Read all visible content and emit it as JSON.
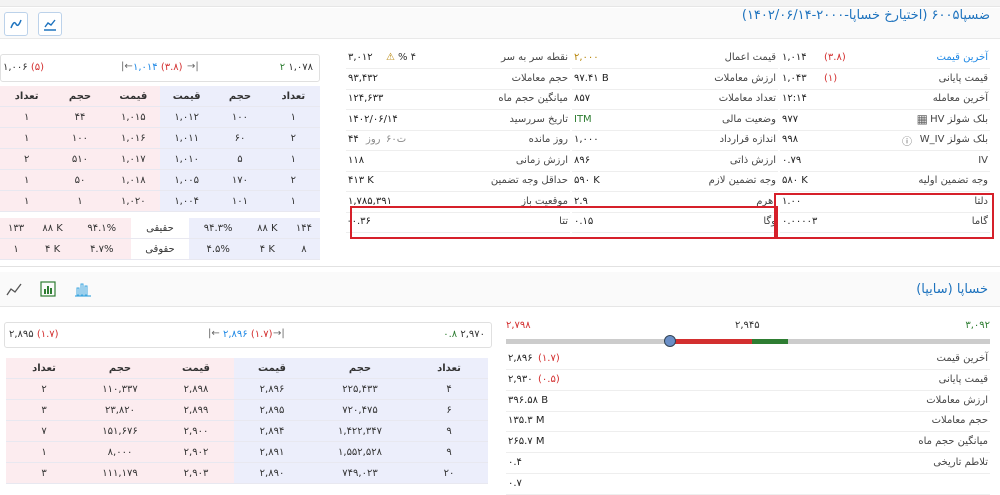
{
  "option": {
    "title": "ضسپا۶۰۰۵ (اختیارخ خساپا-۲۰۰۰-۱۴۰۲/۰۶/۱۴)",
    "col3": [
      {
        "label": "آخرین قیمت",
        "value": "۱,۰۱۴",
        "chg": "(۳.۸)"
      },
      {
        "label": "قیمت پایانی",
        "value": "۱,۰۴۳",
        "chg": "(۱)"
      },
      {
        "label": "آخرین معامله",
        "value": "۱۲:۱۴"
      },
      {
        "label": "بلک شولز HV",
        "value": "۹۷۷"
      },
      {
        "label": "بلک شولز W_IV",
        "value": "۹۹۸"
      },
      {
        "label": "IV",
        "value": "۰.۷۹"
      },
      {
        "label": "وجه تضمین اولیه",
        "value": "۵۸۰ K"
      },
      {
        "label": "دلتا",
        "value": "۱.۰۰"
      },
      {
        "label": "گاما",
        "value": "۰.۰۰۰۰۳"
      }
    ],
    "col2": [
      {
        "label": "قیمت اعمال",
        "value": "۲,۰۰۰"
      },
      {
        "label": "ارزش معاملات",
        "value": "۹۷.۴۱ B"
      },
      {
        "label": "تعداد معاملات",
        "value": "۸۵۷"
      },
      {
        "label": "وضعیت مالی",
        "value": "ITM"
      },
      {
        "label": "اندازه قرارداد",
        "value": "۱,۰۰۰"
      },
      {
        "label": "ارزش ذاتی",
        "value": "۸۹۶"
      },
      {
        "label": "وجه تضمین لازم",
        "value": "۵۹۰ K"
      },
      {
        "label": "اهرم",
        "value": "۲.۹"
      },
      {
        "label": "وگا",
        "value": "۰.۱۵"
      }
    ],
    "col1": [
      {
        "label": "نقطه سر به سر",
        "value": "۳,۰۱۲",
        "pct": "% ۴"
      },
      {
        "label": "حجم معاملات",
        "value": "۹۳,۴۳۲"
      },
      {
        "label": "میانگین حجم ماه",
        "value": "۱۲۴,۶۳۳"
      },
      {
        "label": "تاریخ سررسید",
        "value": "۱۴۰۲/۰۶/۱۴"
      },
      {
        "label": "روز مانده",
        "value": "۴۴",
        "unit": "روز",
        "extra": "۶۰ت"
      },
      {
        "label": "ارزش زمانی",
        "value": "۱۱۸"
      },
      {
        "label": "حداقل وجه تضمین",
        "value": "۴۱۳ K"
      },
      {
        "label": "موقعیت باز",
        "value": "۱,۷۸۵,۳۹۱"
      },
      {
        "label": "تتا",
        "value": "-۰.۳۶"
      }
    ],
    "book": {
      "hi": "۱,۰۷۸",
      "hiMark": "۲",
      "mid": "۱,۰۱۴",
      "midChg": "(۳.۸)",
      "lo": "۱,۰۰۶",
      "loChg": "(۵)",
      "headers": [
        "تعداد",
        "حجم",
        "قیمت",
        "قیمت",
        "حجم",
        "تعداد"
      ],
      "rows": [
        [
          "۱",
          "۱۰۰",
          "۱,۰۱۲",
          "۱,۰۱۵",
          "۴۴",
          "۱"
        ],
        [
          "۲",
          "۶۰",
          "۱,۰۱۱",
          "۱,۰۱۶",
          "۱۰۰",
          "۱"
        ],
        [
          "۱",
          "۵",
          "۱,۰۱۰",
          "۱,۰۱۷",
          "۵۱۰",
          "۲"
        ],
        [
          "۲",
          "۱۷۰",
          "۱,۰۰۵",
          "۱,۰۱۸",
          "۵۰",
          "۱"
        ],
        [
          "۱",
          "۱۰۱",
          "۱,۰۰۴",
          "۱,۰۲۰",
          "۱",
          "۱"
        ]
      ],
      "summary": [
        [
          "۱۴۴",
          "۸۸ K",
          "۹۴.۳%",
          "حقیقی",
          "۹۴.۱%",
          "۸۸ K",
          "۱۳۳"
        ],
        [
          "۸",
          "۴ K",
          "۴.۵%",
          "حقوقی",
          "۴.۷%",
          "۴ K",
          "۱"
        ]
      ]
    }
  },
  "underlying": {
    "title": "خساپا (سایپا)",
    "range": {
      "low": "۲,۷۹۸",
      "mid": "۲,۹۴۵",
      "high": "۳,۰۹۲",
      "marker": 0.05
    },
    "stats": [
      {
        "label": "آخرین قیمت",
        "value": "۲,۸۹۶",
        "chg": "(۱.۷)"
      },
      {
        "label": "قیمت پایانی",
        "value": "۲,۹۳۰",
        "chg": "(۰.۵)"
      },
      {
        "label": "ارزش معاملات",
        "value": "۳۹۶.۵۸ B"
      },
      {
        "label": "حجم معاملات",
        "value": "۱۳۵.۳ M"
      },
      {
        "label": "میانگین حجم ماه",
        "value": "۲۶۵.۷ M"
      },
      {
        "label": "تلاطم تاریخی",
        "value": "۰.۴"
      },
      {
        "label": "",
        "value": "۰.۷"
      }
    ],
    "book": {
      "hi": "۲,۹۷۰",
      "hiMark": "۰.۸",
      "mid": "۲,۸۹۶",
      "midChg": "(۱.۷)",
      "lo": "۲,۸۹۵",
      "loChg": "(۱.۷)",
      "headers": [
        "تعداد",
        "حجم",
        "قیمت",
        "قیمت",
        "حجم",
        "تعداد"
      ],
      "rows": [
        [
          "۴",
          "۲۲۵,۴۳۳",
          "۲,۸۹۶",
          "۲,۸۹۸",
          "۱۱۰,۳۳۷",
          "۲"
        ],
        [
          "۶",
          "۷۲۰,۴۷۵",
          "۲,۸۹۵",
          "۲,۸۹۹",
          "۲۳,۸۲۰",
          "۳"
        ],
        [
          "۹",
          "۱,۴۲۲,۳۴۷",
          "۲,۸۹۴",
          "۲,۹۰۰",
          "۱۵۱,۶۷۶",
          "۷"
        ],
        [
          "۹",
          "۱,۵۵۲,۵۲۸",
          "۲,۸۹۱",
          "۲,۹۰۲",
          "۸,۰۰۰",
          "۱"
        ],
        [
          "۲۰",
          "۷۴۹,۰۲۳",
          "۲,۸۹۰",
          "۲,۹۰۳",
          "۱۱۱,۱۷۹",
          "۳"
        ]
      ]
    }
  }
}
